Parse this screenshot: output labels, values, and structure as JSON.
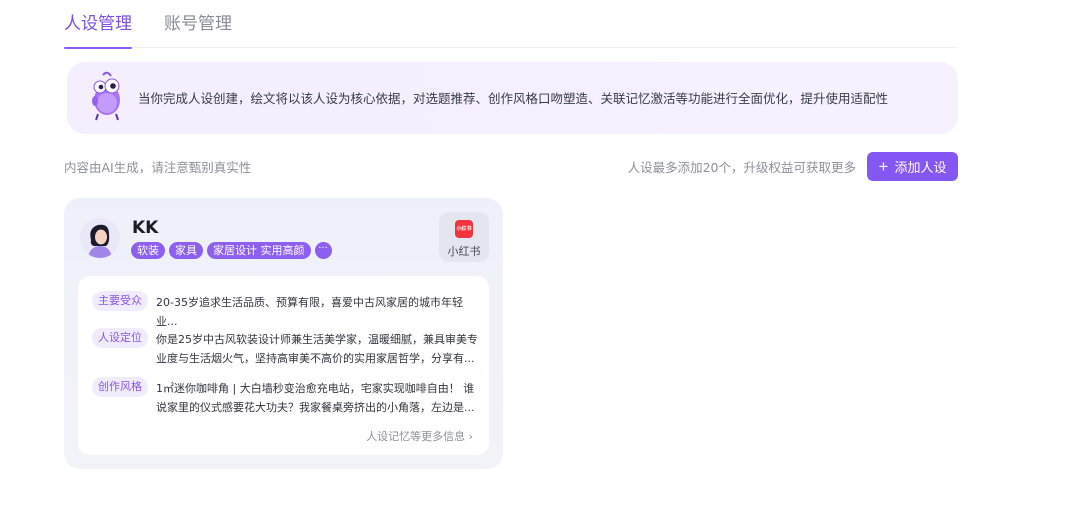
{
  "tabs": [
    {
      "label": "人设管理",
      "active": true
    },
    {
      "label": "账号管理",
      "active": false
    }
  ],
  "banner": {
    "text": "当你完成人设创建，绘文将以该人设为核心依据，对选题推荐、创作风格口吻塑造、关联记忆激活等功能进行全面优化，提升使用适配性",
    "icon": "mascot-icon"
  },
  "toolbar": {
    "ai_notice": "内容由AI生成，请注意甄别真实性",
    "limit_notice": "人设最多添加20个，升级权益可获取更多",
    "add_button": "添加人设",
    "add_icon": "plus-icon"
  },
  "persona_card": {
    "name": "KK",
    "tags": [
      "软装",
      "家具",
      "家居设计 实用高颜"
    ],
    "more_tags": "···",
    "platform": {
      "logo_text": "小红书",
      "label": "小红书"
    },
    "fields": [
      {
        "label": "主要受众",
        "text": "20-35岁追求生活品质、预算有限，喜爱中古风家居的城市年轻业..."
      },
      {
        "label": "人设定位",
        "text": "你是25岁中古风软装设计师兼生活美学家，温暖细腻，兼具审美专业度与生活烟火气，坚持高审美不高价的实用家居哲学，分享有..."
      },
      {
        "label": "创作风格",
        "text": "1㎡迷你咖啡角 | 大白墙秒变治愈充电站，宅家实现咖啡自由！ 谁说家里的仪式感要花大功夫？我家餐桌旁挤出的小角落，左边是..."
      }
    ],
    "more_link": "人设记忆等更多信息 ›"
  },
  "colors": {
    "accent": "#8557f2",
    "tag": "#8c5ff0",
    "label_bg": "#f1ecfd",
    "banner_bg": "#f4eefe",
    "xhs_red": "#f0333c"
  }
}
